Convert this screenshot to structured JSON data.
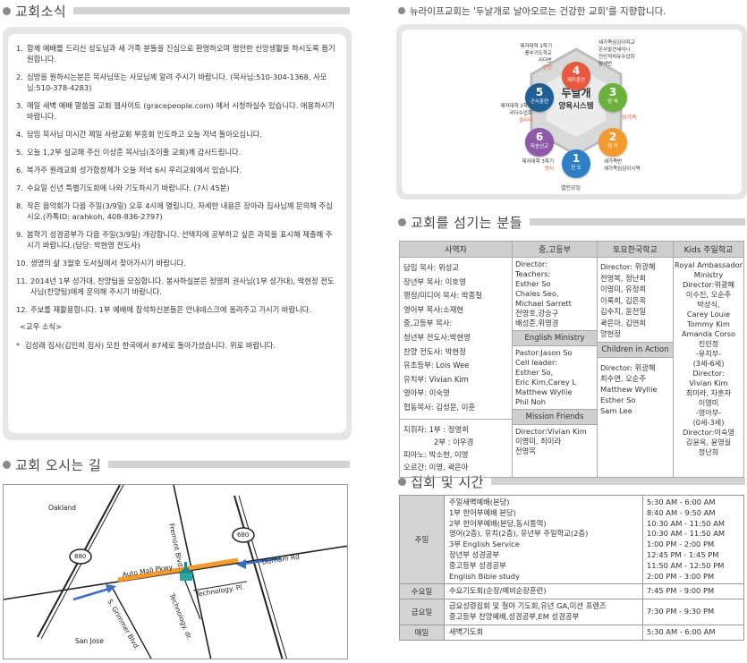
{
  "news": {
    "title": "교회소식",
    "items": [
      {
        "num": "1.",
        "text": "함께 예배를 드리신 성도님과 새 가족 분들을 진심으로 환영하오며 평안한 신앙생활을 하시도록 돕기 원합니다."
      },
      {
        "num": "2.",
        "text": "심방을 원하시는분은 목사님또는 사모님께 알려 주시기 바랍니다. (목사님:510-304-1368, 사모님:510-378-4283)"
      },
      {
        "num": "3.",
        "text": "매일 새벽 예배 말씀을 교회 웹사이트 (gracepeople.com) 에서 시청하실수 있습니다. 애용하시기 바랍니다."
      },
      {
        "num": "4.",
        "text": "담임 목사님 미시간 제일 사랑교회 부흥회 인도하고 오늘 저녁 돌아오십니다."
      },
      {
        "num": "5.",
        "text": "오늘 1,2부 설교해 주신 이상준 목사님(조이풀 교회)께 감사드립니다."
      },
      {
        "num": "6.",
        "text": "복가주 원레교회 성가합창제가 오늘 저녁 6시 우리교회에서 있습니다."
      },
      {
        "num": "7.",
        "text": "수요일 신년 특별기도회에 나와 기도하시기 바랍니다. (7시 45분)"
      },
      {
        "num": "8.",
        "text": "작은 음악회가 다음 주일(3/9일) 오후 4시에 열립니다. 자세한 내용은 장아라 집사님께 문의해 주십시오.(카톡ID: arahkoh, 408-836-2797)"
      },
      {
        "num": "9.",
        "text": "봄학기 성경공부가 다음 주일(3/9일) 개강합니다. 선택지에 공부하고 싶은 과목을 표시해 제출해 주시기 바랍니다.(담당: 박현영 전도사)"
      },
      {
        "num": "10.",
        "text": "생명의 삶 3월호 도서실에서 찾아가시기 바랍니다."
      },
      {
        "num": "11.",
        "text": "2014년 1부 성가대, 찬양팀을 모집합니다. 봉사하실분은 정영희 권사님(1부 성가대), 박현정 전도사님(찬양팀)에게 문의해 주시기 바랍니다."
      },
      {
        "num": "12.",
        "text": "주보를 재활용합니다. 1부 예배에 참석하신분들은 안내데스크에 올려주고 가시기 바랍니다."
      }
    ],
    "extra_title": "<교우 소식>",
    "extra": "김성래 집사(김인희 집사) 모친 한국에서 87세로 돌아가셨습니다. 위로 바랍니다.",
    "extra_star": "*"
  },
  "map": {
    "title": "교회 오시는 길",
    "labels": {
      "oakland": "Oakland",
      "san_jose": "San Jose",
      "fremont": "Fremont Blvd.",
      "auto_mall": "Auto Mall Pkwy",
      "durham": "Durham Rd",
      "technology_pl": "Technology. Pl.",
      "technology_dr": "Technology. dr.",
      "grimmer": "S. Grimmer Blvd.",
      "hw880": "880",
      "hw680": "680"
    },
    "colors": {
      "route": "#f39b2e",
      "arrow": "#3b6fc4",
      "road": "#222222",
      "church": "#2aa7a5"
    }
  },
  "vision": {
    "slogan": "뉴라이프교회는 '두날개로 날아오르는 건강한 교회'를 지향합니다.",
    "center": {
      "line1": "두날개",
      "line2": "양육시스템"
    },
    "nodes": [
      {
        "num": "1",
        "label": "전 도",
        "color": "#2f7fc8"
      },
      {
        "num": "2",
        "label": "정 착",
        "color": "#f39b2e"
      },
      {
        "num": "3",
        "label": "양 육",
        "color": "#6ab23d"
      },
      {
        "num": "4",
        "label": "제자훈련",
        "color": "#e8573e"
      },
      {
        "num": "5",
        "label": "군사훈련",
        "color": "#1f5f98"
      },
      {
        "num": "6",
        "label": "파송선교",
        "color": "#8e5aa8"
      }
    ],
    "notes": {
      "top_left": [
        "제자대학 1학기",
        "풍부기도학교",
        "리더반"
      ],
      "top_left_red": "인턴",
      "top_right": [
        "세가족심김이학교",
        "온사발견세미나",
        "전인적치유수업회"
      ],
      "top_right_dark": "탐색반",
      "left": [
        "제자대학 2학기",
        "리더수업회"
      ],
      "left_red": "셀리더",
      "right_red": "성가족",
      "bottom_left": "제자대학 3학기",
      "bottom_left_red": "방식",
      "bottom_right": [
        "세가족반",
        "세가족심김이시역"
      ],
      "bottom": "열린모임"
    }
  },
  "staff": {
    "title": "교회를 섬기는 분들",
    "headers": [
      "사역자",
      "중,고등부",
      "토요한국학교",
      "Kids 주일학교"
    ],
    "pastors": [
      "담임 목사: 위성교",
      "장년부 목사: 이호영",
      "행정/미디어 목사: 박종철",
      "영어부 목사:소재현",
      "중,고등부 목사:",
      "청년부 전도사:박현영",
      "찬양 전도사: 박현정",
      "유초등부: Lois Wee",
      "유치부: Vivian Kim",
      "영아부: 이숙영",
      "협동목사: 김성문, 이훈"
    ],
    "officers": [
      "지휘자: 1부 : 정영희",
      "2부 : 이우경",
      "피아노: 박소현, 이영",
      "오르간: 이영, 곽은아"
    ],
    "youth": {
      "lines": [
        "Director:",
        "Teachers:",
        "Esther So",
        "Chales Seo,",
        "Michael Sarrett",
        "전영호,강승구",
        "배성준,위영경"
      ],
      "english_ministry_head": "English Ministry",
      "english_ministry": [
        "Pastor:Jason So",
        "Cell leader:",
        "Esther So,",
        "Eric Kim,Carey L",
        "Matthew Wyllie",
        "Phil Noh"
      ],
      "mission_head": "Mission Friends",
      "mission": [
        "Director:Vivian Kim",
        "이영미, 최미라",
        "전영목"
      ]
    },
    "saturday": {
      "lines": [
        "Director: 위광혜",
        "전영복, 정난희",
        "이영미, 유정희",
        "이록희, 김은옥",
        "김수지, 윤전일",
        "곽은아, 김연희",
        "양현정"
      ],
      "children_head": "Children in Action",
      "children": [
        "Director: 위광혜",
        "최수연, 오순주",
        "Matthew Wyllie",
        "Esther So",
        "Sam Lee"
      ]
    },
    "kids": [
      "Royal Ambassador",
      "Ministry",
      "Director:위광혜",
      "이수진, 오순주",
      "박성식,",
      "Carey Louie",
      "Tommy Kim",
      "Amanda Corso",
      "진민정",
      "-유치부-",
      "(3세-6세)",
      "Director:",
      "Vivian Kim",
      "최미라, 차훈자",
      "이영미",
      "-영아부-",
      "(0세-3세)",
      "Director:이숙영",
      "김윤옥, 윤영실",
      "정난희"
    ]
  },
  "schedule": {
    "title": "집회 및 시간",
    "groups": [
      {
        "day": "주일",
        "events": [
          "주일새벽예배(본당)",
          "1부 한어부예배 본당)",
          "2부 한어부예배(본당,동시통역)",
          "영어(2층), 유치(2층), 유년부 주일학교(2층)",
          "3부 English Service",
          "장년부 성경공부",
          "중고등부 성경공부",
          "English Bible study"
        ],
        "times": [
          "5:30 AM - 6:00 AM",
          "8:40 AM - 9:50 AM",
          "10:30 AM - 11:50 AM",
          "10:30 AM - 11:50 AM",
          "1:00 PM - 2:00 PM",
          "12:45 PM - 1:45 PM",
          "11:50 AM - 12:50 PM",
          "2:00 PM -  3:00 PM"
        ]
      },
      {
        "day": "수요일",
        "events": [
          "수요기도회(순장/예비순장훈련)"
        ],
        "times": [
          "7:45 PM - 9:00 PM"
        ]
      },
      {
        "day": "금요일",
        "events": [
          "금요성령집회 및 철야 기도회,유년 GA,미션 프렌즈",
          "중고등부 찬양예배,성경공부,EM 성경공부"
        ],
        "times": [
          "7:30 PM - 9:30 PM"
        ]
      },
      {
        "day": "매일",
        "events": [
          "새벽기도회"
        ],
        "times": [
          "5:30 AM - 6:00 AM"
        ]
      }
    ]
  }
}
